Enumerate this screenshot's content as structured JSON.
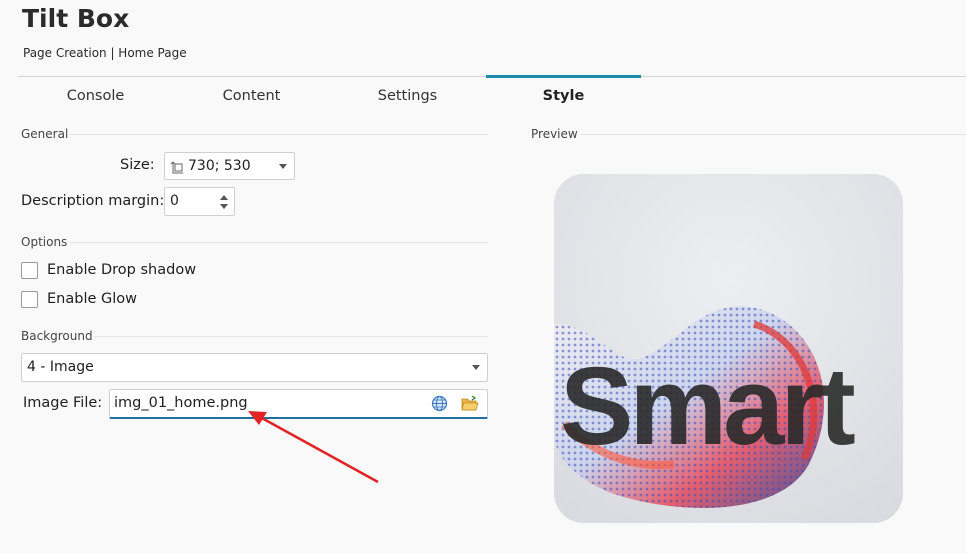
{
  "window": {
    "title": "Tilt Box",
    "breadcrumb": "Page Creation | Home Page"
  },
  "tabs": [
    {
      "label": "Console",
      "active": false
    },
    {
      "label": "Content",
      "active": false
    },
    {
      "label": "Settings",
      "active": false
    },
    {
      "label": "Style",
      "active": true
    }
  ],
  "general": {
    "section_label": "General",
    "size_label": "Size:",
    "size_value": "730; 530",
    "description_margin_label": "Description margin:",
    "description_margin_value": "0"
  },
  "options": {
    "section_label": "Options",
    "drop_shadow_label": "Enable Drop shadow",
    "drop_shadow_checked": false,
    "glow_label": "Enable Glow",
    "glow_checked": false
  },
  "background": {
    "section_label": "Background",
    "type_value": "4 - Image",
    "image_file_label": "Image File:",
    "image_file_value": "img_01_home.png"
  },
  "preview": {
    "section_label": "Preview",
    "image_text": "Smart"
  },
  "colors": {
    "accent": "#1d8aad",
    "annotation_arrow": "#e02424"
  },
  "icons": [
    "size-icon",
    "globe-icon",
    "folder-open-icon"
  ]
}
